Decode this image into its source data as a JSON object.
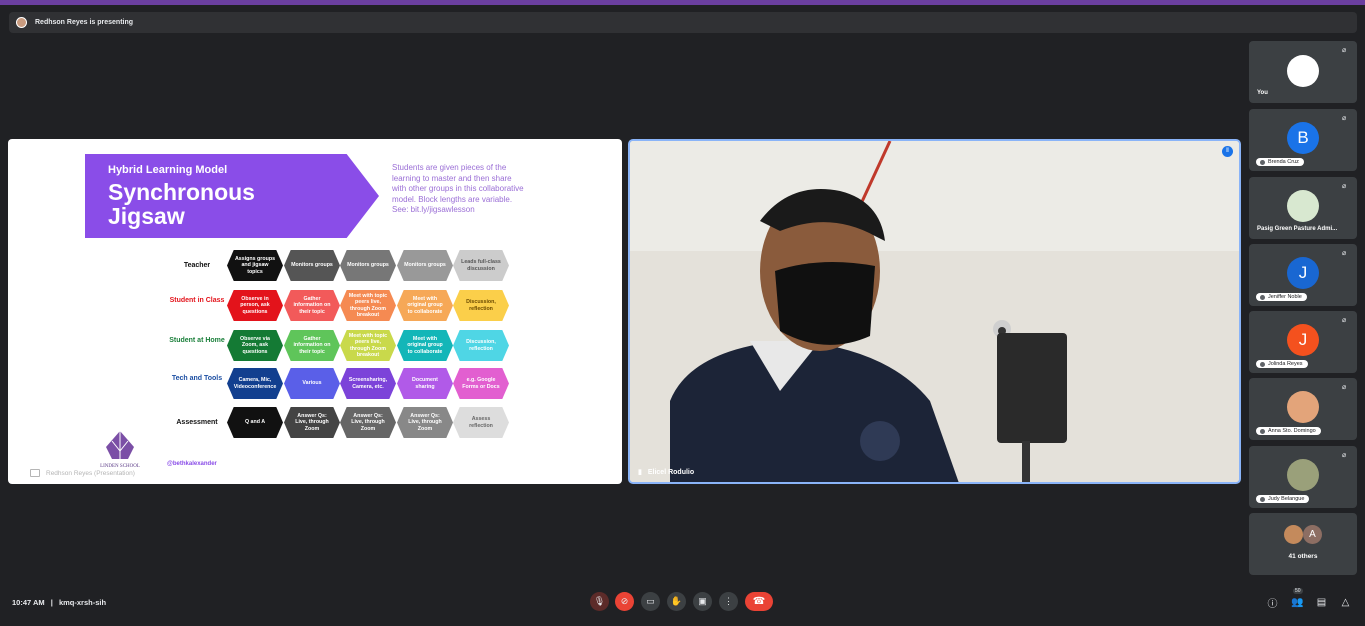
{
  "presenter_banner": {
    "text": "Redhson Reyes is presenting"
  },
  "slide": {
    "small_title": "Hybrid Learning Model",
    "big_title": "Synchronous Jigsaw",
    "description": "Students are given pieces of the learning to master and then share with other groups in this collaborative model. Block lengths are variable. See: bit.ly/jigsawlesson",
    "handle": "@bethkalexander",
    "logo_text": "LINDEN SCHOOL",
    "caption": "Redhson Reyes (Presentation)",
    "rows": [
      {
        "label": "Teacher",
        "color": "#111111",
        "cells": [
          {
            "text": "Assigns groups and jigsaw topics",
            "bg": "#111111",
            "fg": "#ffffff"
          },
          {
            "text": "Monitors groups",
            "bg": "#555555",
            "fg": "#ffffff"
          },
          {
            "text": "Monitors groups",
            "bg": "#777777",
            "fg": "#ffffff"
          },
          {
            "text": "Monitors groups",
            "bg": "#999999",
            "fg": "#ffffff"
          },
          {
            "text": "Leads full-class discussion",
            "bg": "#cccccc",
            "fg": "#555555"
          }
        ]
      },
      {
        "label": "Student in Class",
        "color": "#e3131b",
        "cells": [
          {
            "text": "Observe in person, ask questions",
            "bg": "#e3131b",
            "fg": "#ffffff"
          },
          {
            "text": "Gather information on their topic",
            "bg": "#f25a5a",
            "fg": "#ffffff"
          },
          {
            "text": "Meet with topic peers live, through Zoom breakout",
            "bg": "#f58a52",
            "fg": "#ffffff"
          },
          {
            "text": "Meet with original group to collaborate",
            "bg": "#f6a857",
            "fg": "#ffffff"
          },
          {
            "text": "Discussion, reflection",
            "bg": "#fbcf4a",
            "fg": "#6b4b00"
          }
        ]
      },
      {
        "label": "Student at Home",
        "color": "#1a7f3a",
        "cells": [
          {
            "text": "Observe via Zoom, ask questions",
            "bg": "#147a34",
            "fg": "#ffffff"
          },
          {
            "text": "Gather information on their topic",
            "bg": "#5fc55a",
            "fg": "#ffffff"
          },
          {
            "text": "Meet with topic peers live, through Zoom breakout",
            "bg": "#c9d94b",
            "fg": "#ffffff"
          },
          {
            "text": "Meet with original group to collaborate",
            "bg": "#13b6b8",
            "fg": "#ffffff"
          },
          {
            "text": "Discussion, reflection",
            "bg": "#4fd6e5",
            "fg": "#ffffff"
          }
        ]
      },
      {
        "label": "Tech and Tools",
        "color": "#1d4fa3",
        "cells": [
          {
            "text": "Camera, Mic, Videoconference",
            "bg": "#123f8f",
            "fg": "#ffffff"
          },
          {
            "text": "Various",
            "bg": "#5a5fe8",
            "fg": "#ffffff"
          },
          {
            "text": "Screensharing, Camera, etc.",
            "bg": "#7c43d9",
            "fg": "#ffffff"
          },
          {
            "text": "Document sharing",
            "bg": "#b15ae8",
            "fg": "#ffffff"
          },
          {
            "text": "e.g. Google Forms or Docs",
            "bg": "#e25fd0",
            "fg": "#ffffff"
          }
        ]
      },
      {
        "label": "Assessment",
        "color": "#111111",
        "cells": [
          {
            "text": "Q and A",
            "bg": "#111111",
            "fg": "#ffffff"
          },
          {
            "text": "Answer Qs: Live, through Zoom",
            "bg": "#444444",
            "fg": "#ffffff"
          },
          {
            "text": "Answer Qs: Live, through Zoom",
            "bg": "#666666",
            "fg": "#ffffff"
          },
          {
            "text": "Answer Qs: Live, through Zoom",
            "bg": "#888888",
            "fg": "#ffffff"
          },
          {
            "text": "Assess reflection",
            "bg": "#dddddd",
            "fg": "#666666"
          }
        ]
      }
    ]
  },
  "main_video": {
    "name": "Elicel Rodulio"
  },
  "participants": [
    {
      "name": "You",
      "initial": "",
      "avatar_color": "#ffffff",
      "style": "you"
    },
    {
      "name": "Brenda Cruz",
      "initial": "B",
      "avatar_color": "#1a73e8"
    },
    {
      "name": "Pasig Green Pasture Admi...",
      "initial": "",
      "avatar_color": "#d8e8d0",
      "style": "plain"
    },
    {
      "name": "Jeniffer Noble",
      "initial": "J",
      "avatar_color": "#1967d2"
    },
    {
      "name": "Jolinda Reyes",
      "initial": "J",
      "avatar_color": "#f4511e"
    },
    {
      "name": "Anna Sto. Domingo",
      "initial": "",
      "avatar_color": "#e3a47a"
    },
    {
      "name": "Judy Belangue",
      "initial": "",
      "avatar_color": "#9aa07a"
    }
  ],
  "others": {
    "label": "41 others",
    "initial": "A"
  },
  "bottom": {
    "time": "10:47 AM",
    "separator": "|",
    "meeting_code": "kmq-xrsh-sih",
    "people_count": "50"
  }
}
